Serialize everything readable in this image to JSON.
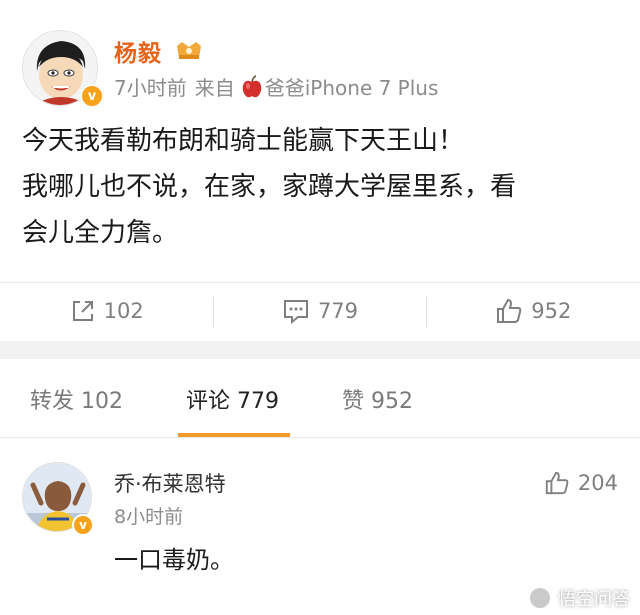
{
  "post": {
    "username": "杨毅",
    "time": "7小时前",
    "source_prefix": "来自",
    "device": "爸爸iPhone 7 Plus",
    "text_lines": [
      "今天我看勒布朗和骑士能赢下天王山！",
      "我哪儿也不说，在家，家蹲大学屋里系，看",
      "会儿全力詹。"
    ]
  },
  "actions": {
    "repost_count": "102",
    "comment_count": "779",
    "like_count": "952"
  },
  "tabs": {
    "repost": "转发 102",
    "comments": "评论 779",
    "likes": "赞 952"
  },
  "comment": {
    "name": "乔·布莱恩特",
    "time": "8小时前",
    "text": "一口毒奶。",
    "likes": "204"
  },
  "watermark": {
    "text": "悟空问答"
  },
  "colors": {
    "username": "#e8631a",
    "tab_underline": "#f29a2e",
    "verify_badge": "#f7a21b"
  }
}
